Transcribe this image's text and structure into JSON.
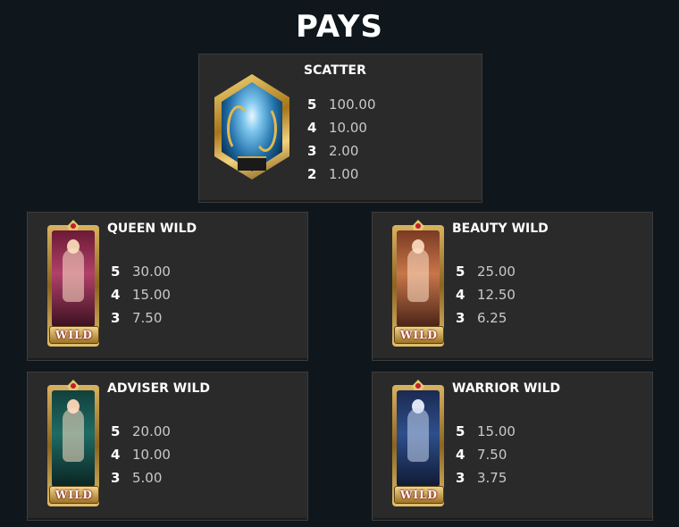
{
  "title": "PAYS",
  "symbols": [
    {
      "name": "SCATTER",
      "pays": [
        {
          "count": "5",
          "value": "100.00"
        },
        {
          "count": "4",
          "value": "10.00"
        },
        {
          "count": "3",
          "value": "2.00"
        },
        {
          "count": "2",
          "value": "1.00"
        }
      ]
    },
    {
      "name": "QUEEN WILD",
      "pays": [
        {
          "count": "5",
          "value": "30.00"
        },
        {
          "count": "4",
          "value": "15.00"
        },
        {
          "count": "3",
          "value": "7.50"
        }
      ]
    },
    {
      "name": "BEAUTY WILD",
      "pays": [
        {
          "count": "5",
          "value": "25.00"
        },
        {
          "count": "4",
          "value": "12.50"
        },
        {
          "count": "3",
          "value": "6.25"
        }
      ]
    },
    {
      "name": "ADVISER WILD",
      "pays": [
        {
          "count": "5",
          "value": "20.00"
        },
        {
          "count": "4",
          "value": "10.00"
        },
        {
          "count": "3",
          "value": "5.00"
        }
      ]
    },
    {
      "name": "WARRIOR WILD",
      "pays": [
        {
          "count": "5",
          "value": "15.00"
        },
        {
          "count": "4",
          "value": "7.50"
        },
        {
          "count": "3",
          "value": "3.75"
        }
      ]
    }
  ],
  "wild_plate_label": "WILD",
  "colors": {
    "background": "#0f171c",
    "card": "#2a2a2a",
    "frame_gold": "#d9b260",
    "queen_accent": "#b0416a",
    "beauty_accent": "#c8764a",
    "adviser_accent": "#1f6b64",
    "warrior_accent": "#2e4f8c"
  }
}
